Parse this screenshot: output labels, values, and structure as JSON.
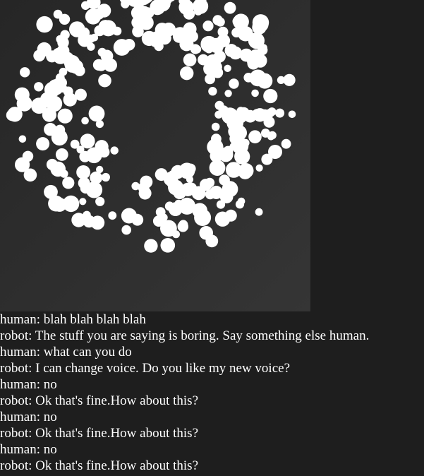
{
  "visualizer": {
    "background": "#2c2c2c",
    "dot_color": "#ffffff"
  },
  "chat": {
    "messages": [
      {
        "speaker": "human",
        "text": "blah blah blah blah"
      },
      {
        "speaker": "robot",
        "text": "The stuff you are saying is boring. Say something else human."
      },
      {
        "speaker": "human",
        "text": "what can you do"
      },
      {
        "speaker": "robot",
        "text": "I can change voice. Do you like my new voice?"
      },
      {
        "speaker": "human",
        "text": "no"
      },
      {
        "speaker": "robot",
        "text": "Ok that's fine.How about this?"
      },
      {
        "speaker": "human",
        "text": "no"
      },
      {
        "speaker": "robot",
        "text": "Ok that's fine.How about this?"
      },
      {
        "speaker": "human",
        "text": "no"
      },
      {
        "speaker": "robot",
        "text": "Ok that's fine.How about this?"
      }
    ]
  }
}
